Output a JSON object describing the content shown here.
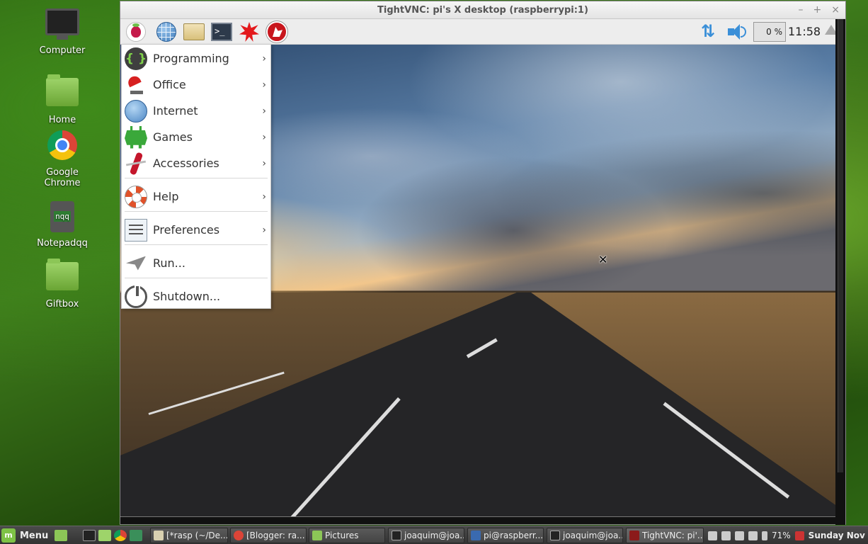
{
  "desktop": {
    "icons": [
      {
        "label": "Computer",
        "icon": "computer-icon"
      },
      {
        "label": "Home",
        "icon": "home-folder-icon"
      },
      {
        "label": "Google Chrome",
        "icon": "chrome-icon"
      },
      {
        "label": "Notepadqq",
        "icon": "notepadqq-icon",
        "badge": "nqq"
      },
      {
        "label": "Giftbox",
        "icon": "folder-icon"
      }
    ]
  },
  "vnc": {
    "title": "TightVNC: pi's X desktop (raspberrypi:1)",
    "controls": [
      "–",
      "+",
      "×"
    ],
    "panel": {
      "launchers": [
        "raspberry-menu-icon",
        "web-browser-icon",
        "file-manager-icon",
        "terminal-icon",
        "mathematica-icon",
        "wolfram-icon"
      ],
      "terminal_glyph": ">_",
      "network_glyph": "⇅",
      "cpu": "0 %",
      "clock": "11:58"
    },
    "cursor_glyph": "✕"
  },
  "menu": {
    "items": [
      {
        "label": "Programming",
        "icon": "programming-icon",
        "arrow": "›",
        "glyph": "{ }"
      },
      {
        "label": "Office",
        "icon": "office-icon",
        "arrow": "›"
      },
      {
        "label": "Internet",
        "icon": "internet-icon",
        "arrow": "›"
      },
      {
        "label": "Games",
        "icon": "games-icon",
        "arrow": "›"
      },
      {
        "label": "Accessories",
        "icon": "accessories-icon",
        "arrow": "›"
      },
      {
        "label": "Help",
        "icon": "help-icon",
        "arrow": "›"
      },
      {
        "label": "Preferences",
        "icon": "preferences-icon",
        "arrow": "›"
      },
      {
        "label": "Run...",
        "icon": "run-icon",
        "arrow": ""
      },
      {
        "label": "Shutdown...",
        "icon": "shutdown-icon",
        "arrow": ""
      }
    ]
  },
  "taskbar": {
    "menu_label": "Menu",
    "tasks": [
      {
        "label": "[*rasp (~/De...",
        "icon_color": "#d8d0b0"
      },
      {
        "label": "[Blogger: ra...",
        "icon_color": "#db4437"
      },
      {
        "label": "Pictures",
        "icon_color": "#8cc657"
      },
      {
        "label": "joaquim@joa...",
        "icon_color": "#222222"
      },
      {
        "label": "pi@raspberr...",
        "icon_color": "#3a6ab0"
      },
      {
        "label": "joaquim@joa...",
        "icon_color": "#222222"
      },
      {
        "label": "TightVNC: pi'...",
        "icon_color": "#8b1a1a"
      }
    ],
    "battery": "71%",
    "date": "Sunday Nov"
  }
}
